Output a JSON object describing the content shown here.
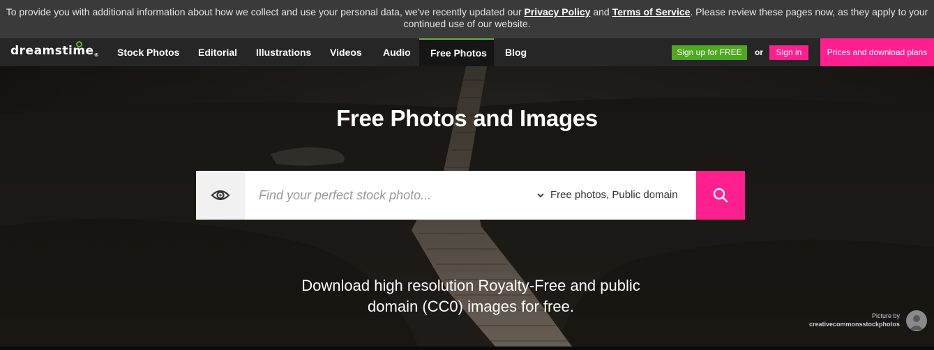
{
  "banner": {
    "text_before": "To provide you with additional information about how we collect and use your personal data, we've recently updated our ",
    "privacy_link": "Privacy Policy",
    "and": " and ",
    "terms_link": "Terms of Service",
    "text_after": ". Please review these pages now, as they apply to your continued use of our website."
  },
  "nav": {
    "logo": "dreamstime",
    "items": [
      {
        "label": "Stock Photos"
      },
      {
        "label": "Editorial"
      },
      {
        "label": "Illustrations"
      },
      {
        "label": "Videos"
      },
      {
        "label": "Audio"
      },
      {
        "label": "Free Photos",
        "active": true
      },
      {
        "label": "Blog"
      }
    ],
    "signup_label": "Sign up for FREE",
    "or_label": "or",
    "signin_label": "Sign in",
    "prices_label": "Prices and download plans"
  },
  "hero": {
    "title": "Free Photos and Images",
    "subtitle": "Download high resolution Royalty-Free and public domain (CC0) images for free.",
    "credit_label": "Picture by",
    "credit_name": "creativecommonsstockphotos"
  },
  "search": {
    "placeholder": "Find your perfect stock photo...",
    "value": "",
    "filter_value": "Free photos, Public domain",
    "eye_icon": "eye-icon",
    "submit_icon": "search-icon",
    "filter_icon": "chevron-down-icon"
  },
  "colors": {
    "accent_pink": "#ff1f8f",
    "accent_green": "#4fa81f",
    "banner_bg": "#3a3a3a",
    "nav_bg": "#262626"
  }
}
